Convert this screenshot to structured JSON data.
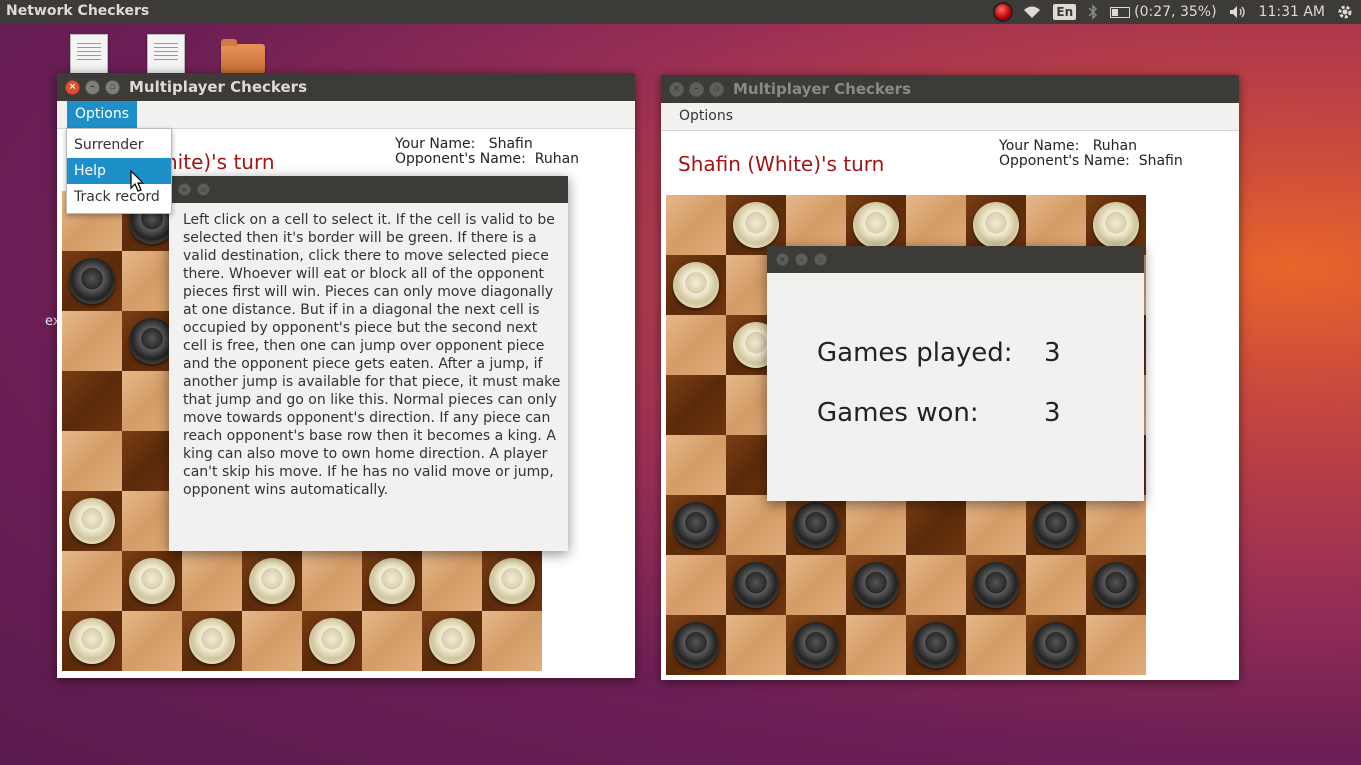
{
  "top_panel": {
    "app_title": "Network Checkers",
    "keyboard_layout": "En",
    "battery": "(0:27, 35%)",
    "clock": "11:31 AM"
  },
  "desktop": {
    "stray_text": "ex"
  },
  "window_left": {
    "title": "Multiplayer Checkers",
    "menu_options": "Options",
    "turn_text": "hite)'s turn",
    "your_name": "Your Name:   Shafin",
    "opponent_name": "Opponent's Name:  Ruhan",
    "board": [
      [
        "",
        "b",
        "",
        "",
        "",
        "",
        "",
        ""
      ],
      [
        "b",
        "",
        "",
        "",
        "",
        "",
        "",
        ""
      ],
      [
        "",
        "b",
        "",
        "",
        "",
        "",
        "",
        ""
      ],
      [
        "",
        "",
        "",
        "",
        "",
        "",
        "",
        ""
      ],
      [
        "",
        "",
        "",
        "",
        "",
        "",
        "",
        ""
      ],
      [
        "w",
        "",
        "",
        "",
        "",
        "",
        "",
        ""
      ],
      [
        "",
        "w",
        "",
        "w",
        "",
        "w",
        "",
        "w"
      ],
      [
        "w",
        "",
        "w",
        "",
        "w",
        "",
        "w",
        ""
      ]
    ]
  },
  "dropdown": {
    "items": [
      "Surrender",
      "Help",
      "Track record"
    ],
    "selected": "Help"
  },
  "help_dialog": {
    "text": "Left click on a cell to select it. If the cell is valid to be selected then it's border will be green. If there is a valid destination, click there to move selected piece there. Whoever will eat or block all of the opponent pieces first will win. Pieces can only move diagonally at one distance. But if in a diagonal the next cell is occupied by opponent's piece but the second next cell is free, then one can jump over opponent piece and the opponent piece gets eaten. After a jump, if another jump is available for that piece, it must make that jump and go on like this. Normal pieces can only move towards opponent's direction. If any piece can reach opponent's base row then it becomes a king. A king can also move to own home direction. A player can't skip his move. If he has no valid move or jump, opponent wins automatically."
  },
  "window_right": {
    "title": "Multiplayer Checkers",
    "menu_options": "Options",
    "turn_text": "Shafin (White)'s turn",
    "your_name": "Your Name:   Ruhan",
    "opponent_name": "Opponent's Name:  Shafin",
    "board": [
      [
        "",
        "w",
        "",
        "w",
        "",
        "w",
        "",
        "w"
      ],
      [
        "w",
        "",
        "",
        "",
        "",
        "",
        "",
        ""
      ],
      [
        "",
        "w",
        "",
        "",
        "",
        "",
        "",
        ""
      ],
      [
        "",
        "",
        "",
        "",
        "",
        "",
        "",
        ""
      ],
      [
        "",
        "",
        "",
        "",
        "",
        "",
        "",
        ""
      ],
      [
        "b",
        "",
        "b",
        "",
        "",
        "",
        "b",
        ""
      ],
      [
        "",
        "b",
        "",
        "b",
        "",
        "b",
        "",
        "b"
      ],
      [
        "b",
        "",
        "b",
        "",
        "b",
        "",
        "b",
        ""
      ]
    ]
  },
  "stats_dialog": {
    "games_played_label": "Games played:",
    "games_played_value": "3",
    "games_won_label": "Games won:",
    "games_won_value": "3"
  }
}
